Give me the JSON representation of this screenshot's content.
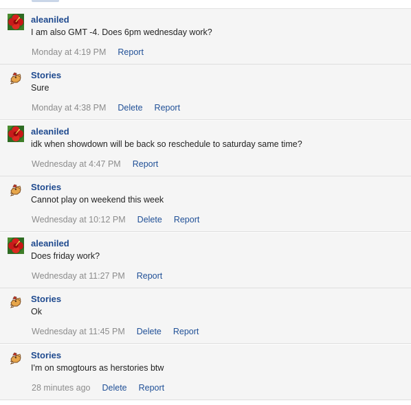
{
  "colors": {
    "username": "#1f4a8f",
    "link": "#1f4f96",
    "timestamp": "#8c8c8c",
    "row_background": "#f5f5f5",
    "divider": "#dedede"
  },
  "messages": [
    {
      "author": "aleaniled",
      "avatar_icon": "red-hibiscus-flower-avatar",
      "text": "I am also GMT -4. Does 6pm wednesday work?",
      "time": "Monday at 4:19 PM",
      "actions": [
        "Report"
      ]
    },
    {
      "author": "Stories",
      "avatar_icon": "pixel-chicken-avatar",
      "text": "Sure",
      "time": "Monday at 4:38 PM",
      "actions": [
        "Delete",
        "Report"
      ]
    },
    {
      "author": "aleaniled",
      "avatar_icon": "red-hibiscus-flower-avatar",
      "text": "idk when showdown will be back so reschedule to saturday same time?",
      "time": "Wednesday at 4:47 PM",
      "actions": [
        "Report"
      ]
    },
    {
      "author": "Stories",
      "avatar_icon": "pixel-chicken-avatar",
      "text": "Cannot play on weekend this week",
      "time": "Wednesday at 10:12 PM",
      "actions": [
        "Delete",
        "Report"
      ]
    },
    {
      "author": "aleaniled",
      "avatar_icon": "red-hibiscus-flower-avatar",
      "text": "Does friday work?",
      "time": "Wednesday at 11:27 PM",
      "actions": [
        "Report"
      ]
    },
    {
      "author": "Stories",
      "avatar_icon": "pixel-chicken-avatar",
      "text": "Ok",
      "time": "Wednesday at 11:45 PM",
      "actions": [
        "Delete",
        "Report"
      ]
    },
    {
      "author": "Stories",
      "avatar_icon": "pixel-chicken-avatar",
      "text": "I'm on smogtours as herstories btw",
      "time": "28 minutes ago",
      "actions": [
        "Delete",
        "Report"
      ]
    }
  ]
}
